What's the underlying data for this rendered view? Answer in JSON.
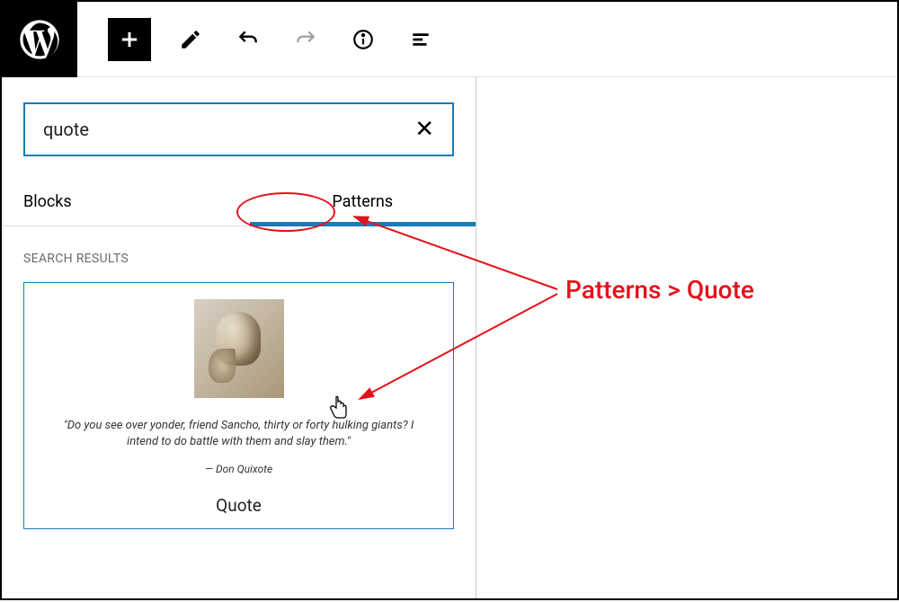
{
  "toolbar": {
    "wp_logo": "WordPress",
    "add_label": "Add block",
    "edit_label": "Tools",
    "undo_label": "Undo",
    "redo_label": "Redo",
    "info_label": "Details",
    "outline_label": "Outline"
  },
  "search": {
    "value": "quote",
    "clear_label": "Clear"
  },
  "tabs": {
    "blocks": "Blocks",
    "patterns": "Patterns"
  },
  "results": {
    "header": "SEARCH RESULTS",
    "patterns": [
      {
        "name": "Quote",
        "quote_text": "\"Do you see over yonder, friend Sancho, thirty or forty hulking giants? I intend to do battle with them and slay them.\"",
        "citation": "— Don Quixote"
      }
    ]
  },
  "annotation": {
    "text": "Patterns > Quote"
  }
}
